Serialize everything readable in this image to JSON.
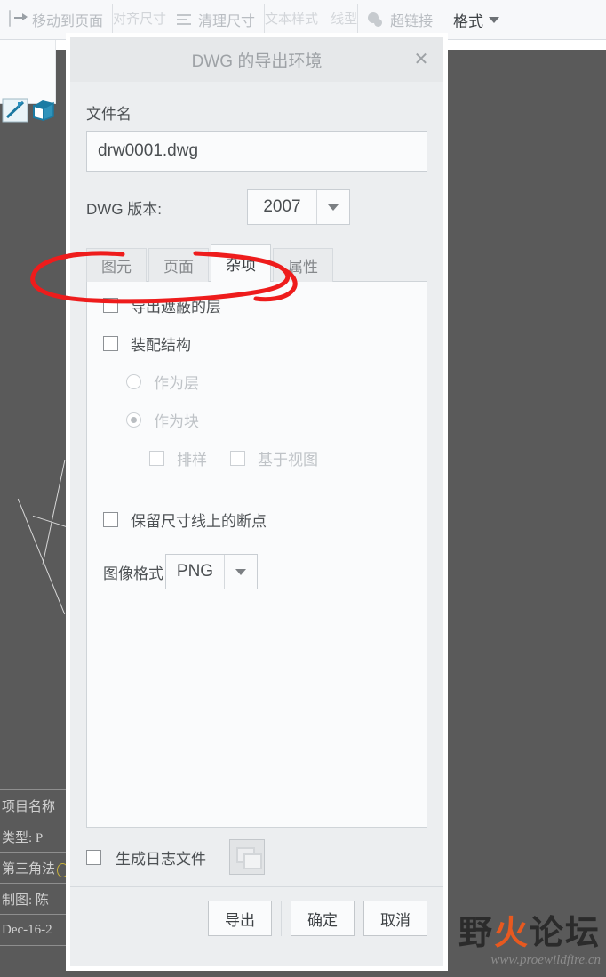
{
  "background": {
    "ribbon": {
      "items": [
        {
          "label": "移动到页面",
          "icon": "move-to-page-icon"
        },
        {
          "label": "对齐尺寸",
          "icon": "align-dimension-icon"
        },
        {
          "label": "清理尺寸",
          "icon": "clean-dimension-icon"
        },
        {
          "label": "文本样式",
          "icon": "text-style-icon"
        },
        {
          "label": "线型",
          "icon": "line-style-icon"
        },
        {
          "label": "超链接",
          "icon": "hyperlink-icon"
        }
      ],
      "right_partial_label": "格式"
    },
    "title_block": {
      "rows": [
        "项目名称",
        "类型: P",
        "第三角法",
        "制图: 陈",
        "Dec-16-2"
      ]
    },
    "watermark": {
      "text_left": "野",
      "text_flame": "火",
      "text_right": "论坛",
      "url": "www.proewildfire.cn"
    }
  },
  "dialog": {
    "title": "DWG 的导出环境",
    "close_label": "✕",
    "filename": {
      "label": "文件名",
      "value": "drw0001.dwg",
      "placeholder": "drw0001.dwg"
    },
    "version": {
      "label": "DWG 版本:",
      "value": "2007"
    },
    "tabs": [
      {
        "label": "图元",
        "active": false
      },
      {
        "label": "页面",
        "active": false
      },
      {
        "label": "杂项",
        "active": true
      },
      {
        "label": "属性",
        "active": false
      }
    ],
    "options": {
      "export_blanked_layers": {
        "label": "导出遮蔽的层",
        "checked": false,
        "enabled": true
      },
      "assembly_structure": {
        "label": "装配结构",
        "checked": false,
        "enabled": true
      },
      "as_layer": {
        "label": "作为层",
        "selected": false,
        "enabled": false
      },
      "as_block": {
        "label": "作为块",
        "selected": true,
        "enabled": false
      },
      "nesting": {
        "label": "排样",
        "checked": false,
        "enabled": false
      },
      "view_based": {
        "label": "基于视图",
        "checked": false,
        "enabled": false
      },
      "keep_breaks": {
        "label": "保留尺寸线上的断点",
        "checked": false,
        "enabled": true
      },
      "image_format": {
        "label": "图像格式",
        "value": "PNG"
      }
    },
    "log": {
      "label": "生成日志文件",
      "checked": false,
      "browse_icon": "window-copy-icon"
    },
    "buttons": {
      "export": "导出",
      "ok": "确定",
      "cancel": "取消"
    }
  },
  "annotation": {
    "color": "#ee1c1c",
    "shape": "hand-drawn-ellipse-highlight"
  }
}
